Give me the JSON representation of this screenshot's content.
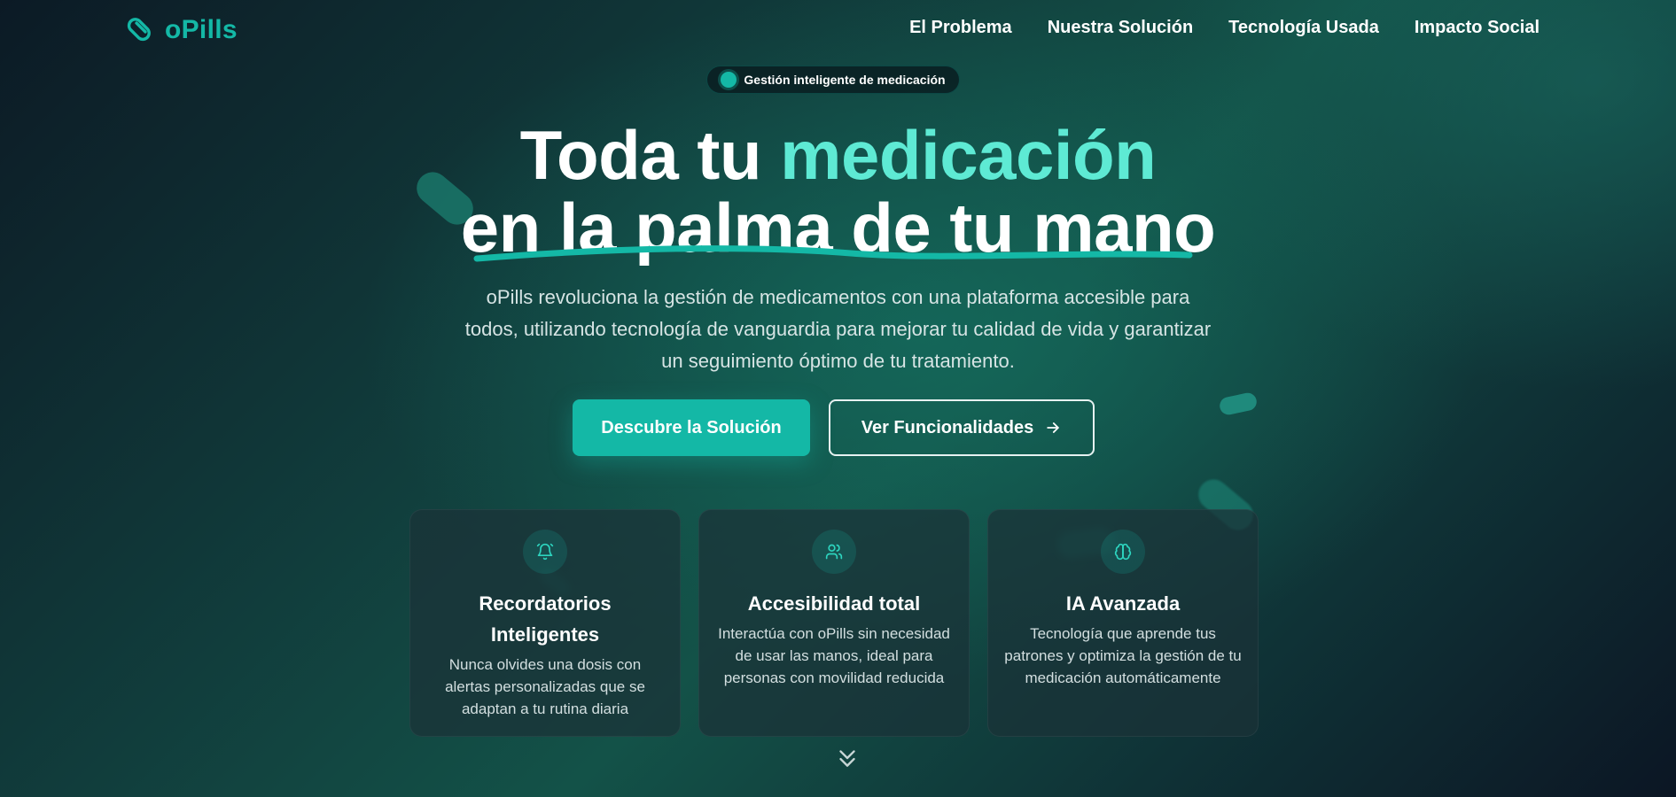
{
  "brand": {
    "name": "oPills",
    "icon": "pill-icon",
    "accent": "#14b8a6"
  },
  "nav": {
    "links": [
      "El Problema",
      "Nuestra Solución",
      "Tecnología Usada",
      "Impacto Social"
    ]
  },
  "badge": {
    "text": "Gestión inteligente de medicación"
  },
  "hero": {
    "title_part1": "Toda tu ",
    "title_accent": "medicación",
    "title_line2": "en la palma de tu mano",
    "description": "oPills revoluciona la gestión de medicamentos con una plataforma accesible para todos, utilizando tecnología de vanguardia para mejorar tu calidad de vida y garantizar un seguimiento óptimo de tu tratamiento.",
    "primary_button": "Descubre la Solución",
    "secondary_button": "Ver Funcionalidades",
    "secondary_icon": "arrow-right-icon"
  },
  "features": [
    {
      "icon": "bell-icon",
      "title": "Recordatorios Inteligentes",
      "text": "Nunca olvides una dosis con alertas personalizadas que se adaptan a tu rutina diaria"
    },
    {
      "icon": "users-icon",
      "title": "Accesibilidad total",
      "text": "Interactúa con oPills sin necesidad de usar las manos, ideal para personas con movilidad reducida"
    },
    {
      "icon": "brain-icon",
      "title": "IA Avanzada",
      "text": "Tecnología que aprende tus patrones y optimiza la gestión de tu medicación automáticamente"
    }
  ],
  "scroll_icon": "chevrons-down-icon",
  "colors": {
    "accent": "#14b8a6",
    "accent_light": "#5eead4"
  }
}
